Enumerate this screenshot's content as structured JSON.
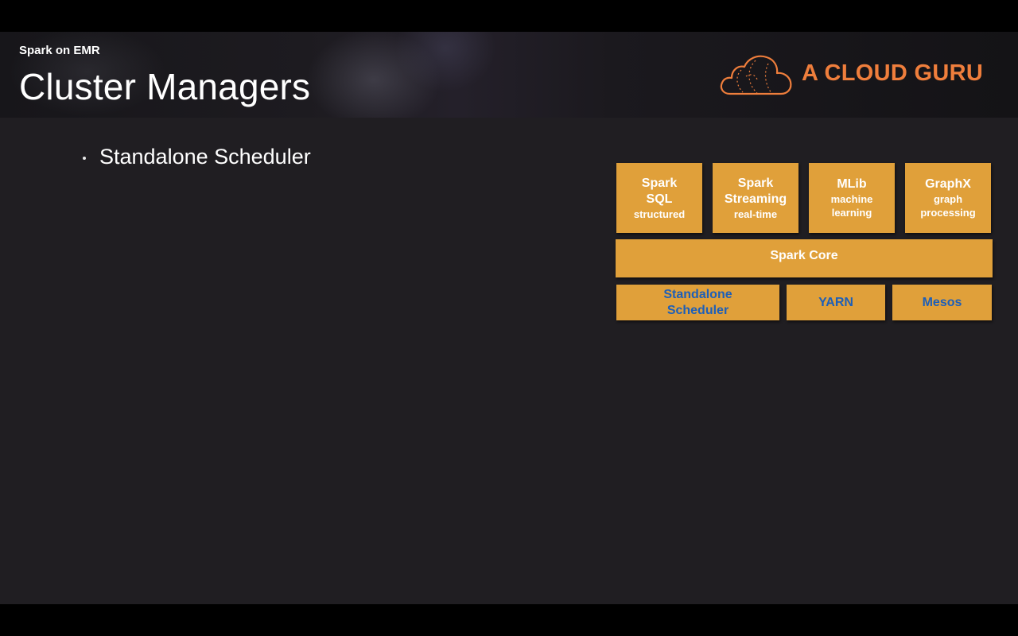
{
  "slide": {
    "subtitle": "Spark on EMR",
    "title": "Cluster Managers",
    "bullets": [
      "Standalone Scheduler"
    ]
  },
  "logo": {
    "text": "A CLOUD GURU",
    "icon": "cloud-icon",
    "color": "#ef7e3c"
  },
  "diagram": {
    "box_color": "#e0a03a",
    "cluster_manager_text_color": "#1d5fb8",
    "libraries": [
      {
        "name": "Spark SQL",
        "sub": "structured"
      },
      {
        "name": "Spark Streaming",
        "sub": "real-time"
      },
      {
        "name": "MLib",
        "sub": "machine learning"
      },
      {
        "name": "GraphX",
        "sub": "graph processing"
      }
    ],
    "core": "Spark Core",
    "cluster_managers": [
      "Standalone Scheduler",
      "YARN",
      "Mesos"
    ]
  }
}
